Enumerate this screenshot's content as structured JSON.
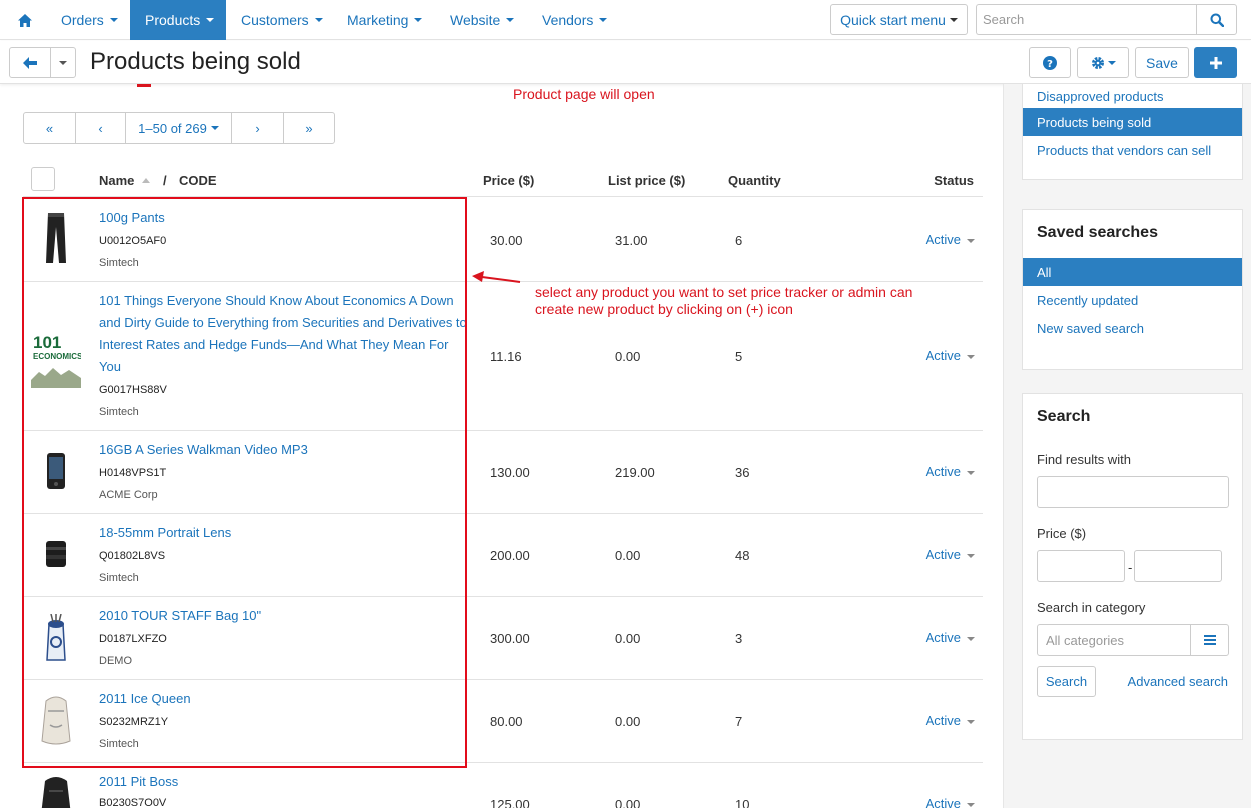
{
  "nav": {
    "items": [
      {
        "label": "Orders"
      },
      {
        "label": "Products"
      },
      {
        "label": "Customers"
      },
      {
        "label": "Marketing"
      },
      {
        "label": "Website"
      },
      {
        "label": "Vendors"
      }
    ],
    "quick_start": "Quick start menu",
    "search_placeholder": "Search"
  },
  "titlebar": {
    "title": "Products being sold",
    "save_label": "Save"
  },
  "annotations": {
    "top": "Product page will open",
    "middle": "select any product you want to set price tracker or admin can create new product by clicking on (+) icon"
  },
  "pager": {
    "first": "«",
    "prev": "‹",
    "range": "1–50 of 269",
    "next": "›",
    "last": "»"
  },
  "table": {
    "headers": {
      "name": "Name",
      "sep": "/",
      "code": "CODE",
      "price": "Price ($)",
      "list_price": "List price ($)",
      "quantity": "Quantity",
      "status": "Status"
    },
    "rows": [
      {
        "name": "100g Pants",
        "code": "U0012O5AF0",
        "vendor": "Simtech",
        "price": "30.00",
        "list_price": "31.00",
        "quantity": "6",
        "status": "Active",
        "thumb_icon": "pants-icon"
      },
      {
        "name": "101 Things Everyone Should Know About Economics A Down and Dirty Guide to Everything from Securities and Derivatives to Interest Rates and Hedge Funds—And What They Mean For You",
        "code": "G0017HS88V",
        "vendor": "Simtech",
        "price": "11.16",
        "list_price": "0.00",
        "quantity": "5",
        "status": "Active",
        "thumb_icon": "book-icon",
        "thumb_text": "101 ECONOMICS"
      },
      {
        "name": "16GB A Series Walkman Video MP3",
        "code": "H0148VPS1T",
        "vendor": "ACME Corp",
        "price": "130.00",
        "list_price": "219.00",
        "quantity": "36",
        "status": "Active",
        "thumb_icon": "mp3-player-icon"
      },
      {
        "name": "18-55mm Portrait Lens",
        "code": "Q01802L8VS",
        "vendor": "Simtech",
        "price": "200.00",
        "list_price": "0.00",
        "quantity": "48",
        "status": "Active",
        "thumb_icon": "lens-icon"
      },
      {
        "name": "2010 TOUR STAFF Bag 10\"",
        "code": "D0187LXFZO",
        "vendor": "DEMO",
        "price": "300.00",
        "list_price": "0.00",
        "quantity": "3",
        "status": "Active",
        "thumb_icon": "golf-bag-icon"
      },
      {
        "name": "2011 Ice Queen",
        "code": "S0232MRZ1Y",
        "vendor": "Simtech",
        "price": "80.00",
        "list_price": "0.00",
        "quantity": "7",
        "status": "Active",
        "thumb_icon": "backpack-icon"
      },
      {
        "name": "2011 Pit Boss",
        "code": "B0230S7O0V",
        "vendor": "",
        "price": "125.00",
        "list_price": "0.00",
        "quantity": "10",
        "status": "Active",
        "thumb_icon": "backpack-dark-icon"
      }
    ]
  },
  "sidebar": {
    "product_lists": [
      {
        "label": "Disapproved products",
        "active": false
      },
      {
        "label": "Products being sold",
        "active": true
      },
      {
        "label": "Products that vendors can sell",
        "active": false
      }
    ],
    "saved_searches": {
      "title": "Saved searches",
      "items": [
        {
          "label": "All",
          "active": true
        },
        {
          "label": "Recently updated",
          "active": false
        },
        {
          "label": "New saved search",
          "active": false
        }
      ]
    },
    "search": {
      "title": "Search",
      "find_label": "Find results with",
      "price_label": "Price ($)",
      "price_sep": "-",
      "category_label": "Search in category",
      "category_placeholder": "All categories",
      "search_button": "Search",
      "advanced_link": "Advanced search"
    }
  },
  "colors": {
    "accent": "#2b7fc1",
    "link": "#1b74bb",
    "annotation": "#d9141e"
  }
}
